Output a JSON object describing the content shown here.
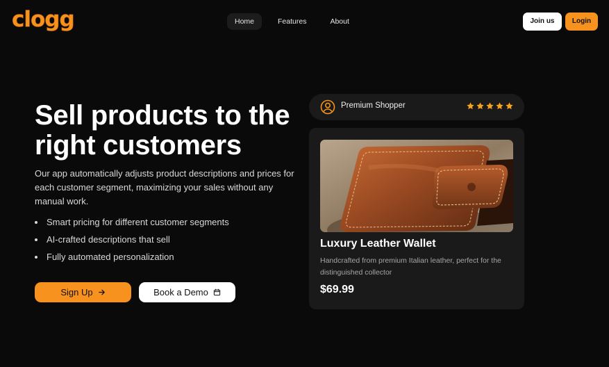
{
  "header": {
    "logo": "clogg",
    "nav": [
      {
        "label": "Home",
        "active": true
      },
      {
        "label": "Features",
        "active": false
      },
      {
        "label": "About",
        "active": false
      }
    ],
    "join_label": "Join us",
    "login_label": "Login"
  },
  "hero": {
    "headline_line1": "Sell products to the",
    "headline_line2": "right customers",
    "description": "Our app automatically adjusts product descriptions and prices for each customer segment, maximizing your sales without any manual work.",
    "bullets": [
      "Smart pricing for different customer segments",
      "AI-crafted descriptions that sell",
      "Fully automated personalization"
    ],
    "signup_label": "Sign Up",
    "signup_icon": "arrow-right-icon",
    "demo_label": "Book a Demo",
    "demo_icon": "calendar-icon"
  },
  "shopper": {
    "icon": "user-circle-icon",
    "label": "Premium Shopper",
    "rating": 5,
    "rating_max": 5
  },
  "product": {
    "image": "leather-wallet-photo",
    "name": "Luxury Leather Wallet",
    "description": "Handcrafted from premium Italian leather, perfect for the distinguished collector",
    "price": "$69.99"
  },
  "colors": {
    "accent": "#f7921e",
    "background": "#0a0a0a",
    "card": "#1a1a1a",
    "star": "#f7a21e"
  }
}
